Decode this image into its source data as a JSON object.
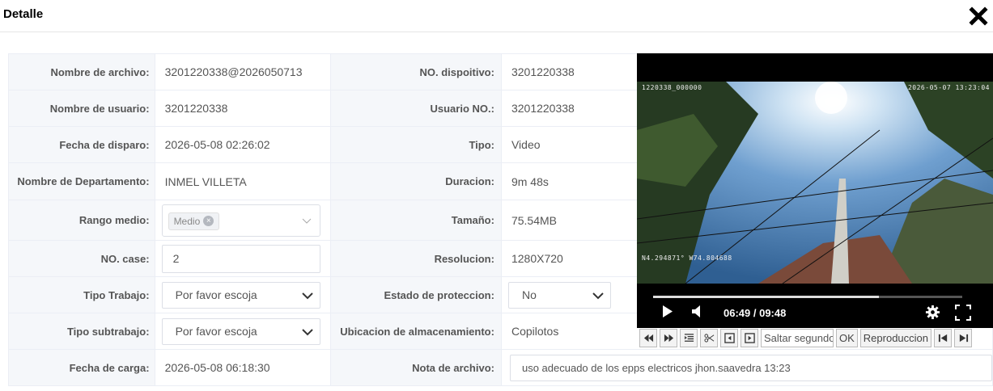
{
  "dialog": {
    "title": "Detalle"
  },
  "rows": {
    "nombre_archivo": {
      "label": "Nombre de archivo:",
      "value": "3201220338@2026050713"
    },
    "no_dispositivo": {
      "label": "NO. dispoitivo:",
      "value": "3201220338"
    },
    "nombre_usuario": {
      "label": "Nombre de usuario:",
      "value": "3201220338"
    },
    "usuario_no": {
      "label": "Usuario NO.:",
      "value": "3201220338"
    },
    "fecha_disparo": {
      "label": "Fecha de disparo:",
      "value": "2026-05-08 02:26:02"
    },
    "tipo": {
      "label": "Tipo:",
      "value": "Video"
    },
    "departamento": {
      "label": "Nombre de Departamento:",
      "value": "INMEL VILLETA"
    },
    "duracion": {
      "label": "Duracion:",
      "value": "9m 48s"
    },
    "rango_medio": {
      "label": "Rango medio:",
      "tag": "Medio"
    },
    "tamano": {
      "label": "Tamaño:",
      "value": "75.54MB"
    },
    "no_case": {
      "label": "NO. case:",
      "value": "2"
    },
    "resolucion": {
      "label": "Resolucion:",
      "value": "1280X720"
    },
    "tipo_trabajo": {
      "label": "Tipo Trabajo:",
      "value": "Por favor escoja"
    },
    "estado_proteccion": {
      "label": "Estado de proteccion:",
      "value": "No"
    },
    "tipo_subtrabajo": {
      "label": "Tipo subtrabajo:",
      "value": "Por favor escoja"
    },
    "ubicacion": {
      "label": "Ubicacion de almacenamiento:",
      "value": "Copilotos"
    },
    "fecha_carga": {
      "label": "Fecha de carga:",
      "value": "2026-05-08 06:18:30"
    },
    "nota_archivo": {
      "label": "Nota de archivo:",
      "value": "uso adecuado de los epps electricos jhon.saavedra 13:23"
    }
  },
  "player": {
    "osd_top_left": "1220338_000000",
    "osd_top_right": "2026-05-07 13:23:04",
    "osd_bottom_left": "N4.294871° W74.804688",
    "time": "06:49 / 09:48",
    "progress_fraction": 0.73
  },
  "toolbar": {
    "skip_placeholder": "Saltar segundos",
    "ok_label": "OK",
    "playback_label": "Reproduccion"
  }
}
